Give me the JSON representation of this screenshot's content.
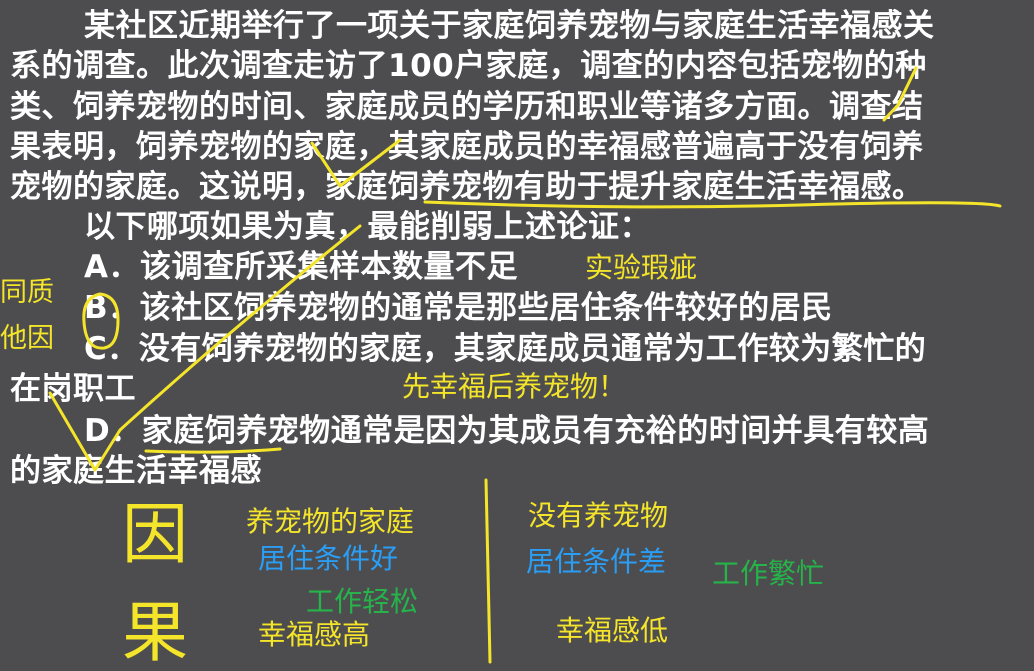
{
  "question": {
    "stem_lines": [
      "某社区近期举行了一项关于家庭饲养宠物与家庭生活幸福感关",
      "系的调查。此次调查走访了100户家庭，调查的内容包括宠物的种",
      "类、饲养宠物的时间、家庭成员的学历和职业等诸多方面。调查结",
      "果表明，饲养宠物的家庭，其家庭成员的幸福感普遍高于没有饲养",
      "宠物的家庭。这说明，家庭饲养宠物有助于提升家庭生活幸福感。"
    ],
    "prompt": "以下哪项如果为真，最能削弱上述论证：",
    "options": {
      "A": "A．该调查所采集样本数量不足",
      "B": "B．该社区饲养宠物的通常是那些居住条件较好的居民",
      "C_line1": "C．没有饲养宠物的家庭，其家庭成员通常为工作较为繁忙的",
      "C_line2": "在岗职工",
      "D_line1": "D．家庭饲养宠物通常是因为其成员有充裕的时间并具有较高",
      "D_line2": "的家庭生活幸福感"
    }
  },
  "annotations": {
    "note_a": "实验瑕疵",
    "side_same": "同质",
    "side_other": "他因",
    "note_d": "先幸福后养宠物！",
    "cause_char": "因",
    "effect_char": "果",
    "left_col": {
      "header": "养宠物的家庭",
      "condition": "居住条件好",
      "work": "工作轻松",
      "result": "幸福感高"
    },
    "right_col": {
      "header": "没有养宠物",
      "condition": "居住条件差",
      "work": "工作繁忙",
      "result": "幸福感低"
    }
  },
  "colors": {
    "background": "#4d4d4f",
    "text": "#ffffff",
    "annotation_yellow": "#f4e42a",
    "annotation_blue": "#2a9df4",
    "annotation_green": "#25b34a"
  }
}
